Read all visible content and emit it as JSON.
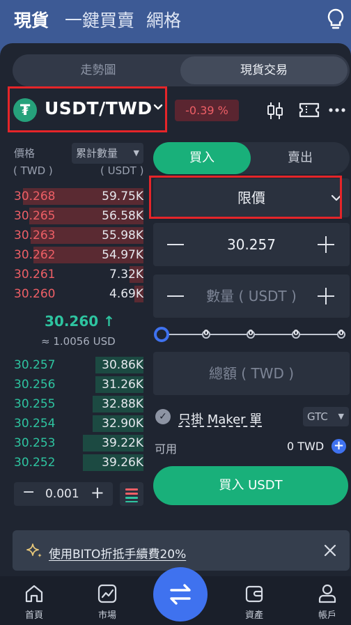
{
  "top_tabs": {
    "spot": "現貨",
    "one_click": "一鍵買賣",
    "grid": "網格"
  },
  "segment": {
    "chart": "走勢圖",
    "trade": "現貨交易"
  },
  "pair": {
    "name": "USDT/TWD",
    "change": "-0.39 %",
    "coin_glyph": "₮"
  },
  "orderbook": {
    "price_label": "價格",
    "price_unit": "( TWD )",
    "qty_dropdown": "累計數量",
    "qty_unit": "( USDT )",
    "asks": [
      {
        "price": "30.268",
        "qty": "59.75K",
        "depth": 0.93
      },
      {
        "price": "30.265",
        "qty": "56.58K",
        "depth": 0.88
      },
      {
        "price": "30.263",
        "qty": "55.98K",
        "depth": 0.87
      },
      {
        "price": "30.262",
        "qty": "54.97K",
        "depth": 0.85
      },
      {
        "price": "30.261",
        "qty": "7.32K",
        "depth": 0.11
      },
      {
        "price": "30.260",
        "qty": "4.69K",
        "depth": 0.07
      }
    ],
    "last_price": "30.260 ↑",
    "usd_equiv": "≈ 1.0056 USD",
    "bids": [
      {
        "price": "30.257",
        "qty": "30.86K",
        "depth": 0.37
      },
      {
        "price": "30.256",
        "qty": "31.26K",
        "depth": 0.37
      },
      {
        "price": "30.255",
        "qty": "32.88K",
        "depth": 0.39
      },
      {
        "price": "30.254",
        "qty": "32.90K",
        "depth": 0.39
      },
      {
        "price": "30.253",
        "qty": "39.22K",
        "depth": 0.47
      },
      {
        "price": "30.252",
        "qty": "39.26K",
        "depth": 0.47
      }
    ],
    "step": "0.001"
  },
  "trade": {
    "buy": "買入",
    "sell": "賣出",
    "order_type": "限價",
    "price_value": "30.257",
    "amount_placeholder": "數量 ( USDT )",
    "slider_marks": [
      "0",
      "0",
      "0",
      "0"
    ],
    "total_placeholder": "總額 ( TWD )",
    "maker_only": "只掛 Maker 單",
    "tif": "GTC",
    "available_label": "可用",
    "available_value": "0 TWD",
    "buy_button": "買入 USDT"
  },
  "banner": {
    "text": "使用BITO折抵手續費20%"
  },
  "nav": {
    "home": "首頁",
    "market": "市場",
    "assets": "資產",
    "account": "帳戶"
  },
  "colors": {
    "accent": "#3f72ef",
    "buy": "#19b07a",
    "ask": "#ee5f66",
    "bid": "#2ec4a0",
    "header": "#3d5a95"
  }
}
